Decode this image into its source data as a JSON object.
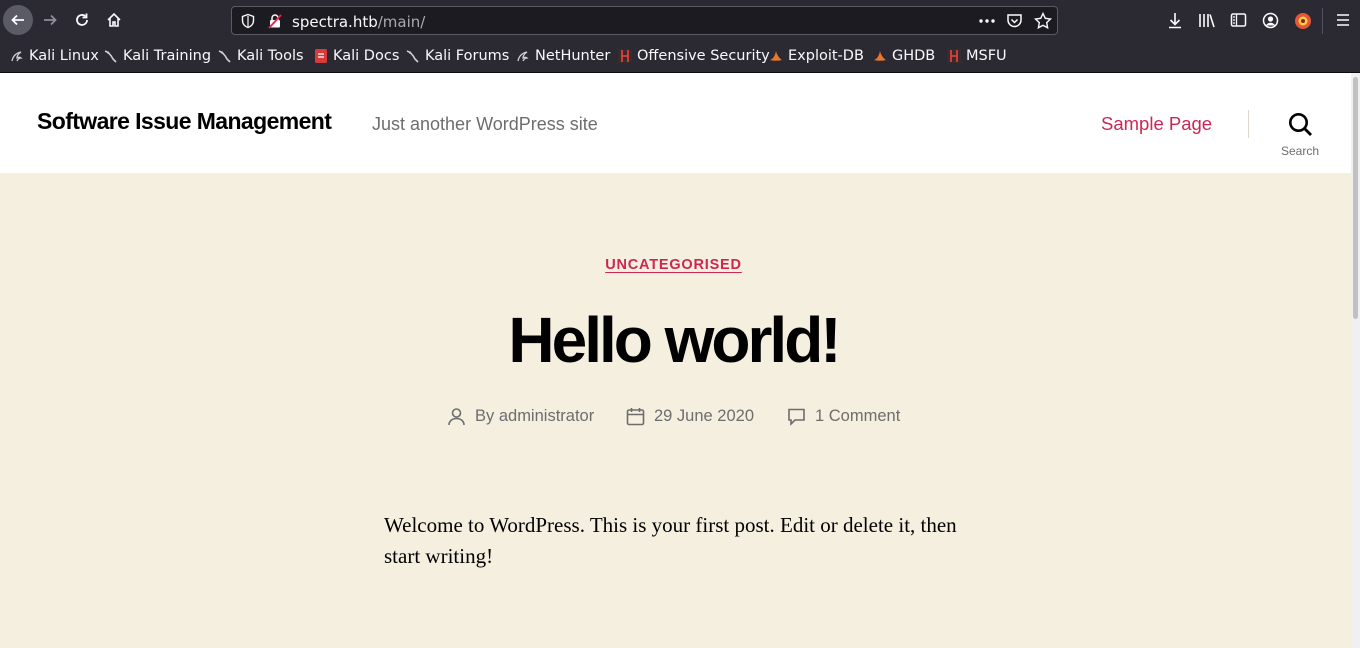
{
  "browser": {
    "url_host": "spectra.htb",
    "url_path": "/main/",
    "bookmarks": [
      {
        "label": "Kali Linux",
        "icon": "kali-dragon-icon"
      },
      {
        "label": "Kali Training",
        "icon": "kali-dragon-icon"
      },
      {
        "label": "Kali Tools",
        "icon": "kali-dragon-icon"
      },
      {
        "label": "Kali Docs",
        "icon": "kali-docs-icon"
      },
      {
        "label": "Kali Forums",
        "icon": "kali-dragon-icon"
      },
      {
        "label": "NetHunter",
        "icon": "nethunter-icon"
      },
      {
        "label": "Offensive Security",
        "icon": "offsec-icon"
      },
      {
        "label": "Exploit-DB",
        "icon": "exploit-db-icon"
      },
      {
        "label": "GHDB",
        "icon": "exploit-db-icon"
      },
      {
        "label": "MSFU",
        "icon": "offsec-icon"
      }
    ]
  },
  "site": {
    "title": "Software Issue Management",
    "description": "Just another WordPress site",
    "nav_item": "Sample Page",
    "search_label": "Search",
    "accent_color": "#cd2653"
  },
  "post": {
    "category": "UNCATEGORISED",
    "title": "Hello world!",
    "author": "By administrator",
    "date": "29 June 2020",
    "comments": "1 Comment",
    "body": "Welcome to WordPress. This is your first post. Edit or delete it, then start writing!"
  }
}
